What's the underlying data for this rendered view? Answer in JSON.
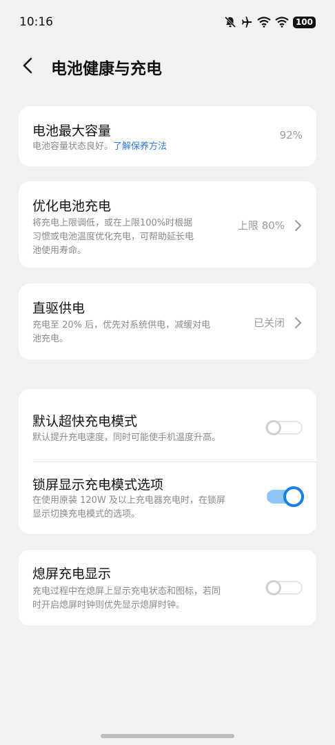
{
  "status": {
    "time": "10:16",
    "battery": "100"
  },
  "header": {
    "title": "电池健康与充电"
  },
  "capacity": {
    "title": "电池最大容量",
    "desc": "电池容量状态良好。",
    "link": "了解保养方法",
    "value": "92%"
  },
  "optimize": {
    "title": "优化电池充电",
    "desc_lines": [
      "将充电上限调低，或在上限100%时根据",
      "习惯或电池温度优化充电，可帮助延长电",
      "池使用寿命。"
    ],
    "value": "上限 80%"
  },
  "direct": {
    "title": "直驱供电",
    "desc_lines": [
      "充电至 20% 后，优先对系统供电，减缓对电",
      "池充电。"
    ],
    "value": "已关闭"
  },
  "fast_mode": {
    "title": "默认超快充电模式",
    "desc": "默认提升充电速度，同时可能使手机温度升高。",
    "enabled": false
  },
  "lock_mode": {
    "title": "锁屏显示充电模式选项",
    "desc_lines": [
      "在使用原装 120W 及以上充电器充电时，在锁屏",
      "显示切换充电模式的选项。"
    ],
    "enabled": true
  },
  "screen_off": {
    "title": "熄屏充电显示",
    "desc_lines": [
      "充电过程中在熄屏上显示充电状态和图标，若同",
      "时开启熄屏时钟则优先显示熄屏时钟。"
    ],
    "enabled": false
  }
}
